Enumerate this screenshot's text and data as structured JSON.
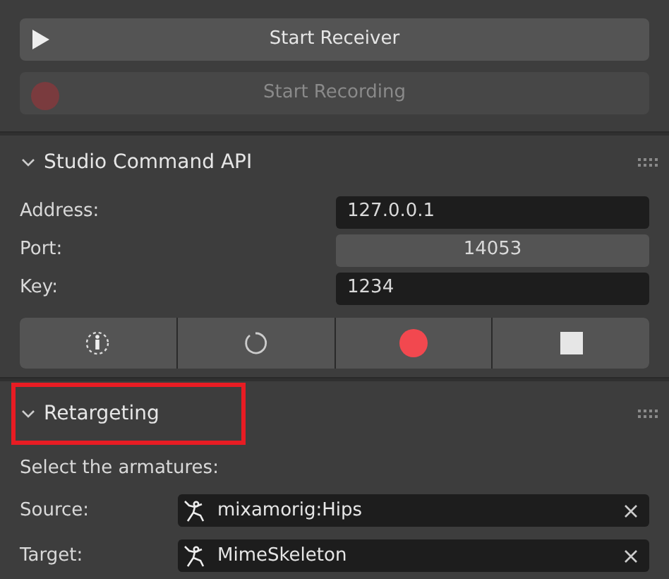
{
  "receiver_buttons": [
    {
      "label": "Start Receiver",
      "kind": "play",
      "disabled": false
    },
    {
      "label": "Start Recording",
      "kind": "record",
      "disabled": true
    }
  ],
  "sections": [
    {
      "title": "Studio Command API",
      "expanded": true,
      "highlighted": false
    },
    {
      "title": "Retargeting",
      "expanded": true,
      "highlighted": true
    }
  ],
  "command_fields": [
    {
      "label": "Address:",
      "value": "127.0.0.1",
      "kind": "text"
    },
    {
      "label": "Port:",
      "value": "14053",
      "kind": "number"
    },
    {
      "label": "Key:",
      "value": "1234",
      "kind": "text"
    }
  ],
  "command_buttons": [
    {
      "kind": "calibrate"
    },
    {
      "kind": "refresh"
    },
    {
      "kind": "record"
    },
    {
      "kind": "stop"
    }
  ],
  "retargeting": {
    "hint": "Select the armatures:",
    "fields": [
      {
        "label": "Source:",
        "value": "mixamorig:Hips"
      },
      {
        "label": "Target:",
        "value": "MimeSkeleton"
      }
    ]
  }
}
